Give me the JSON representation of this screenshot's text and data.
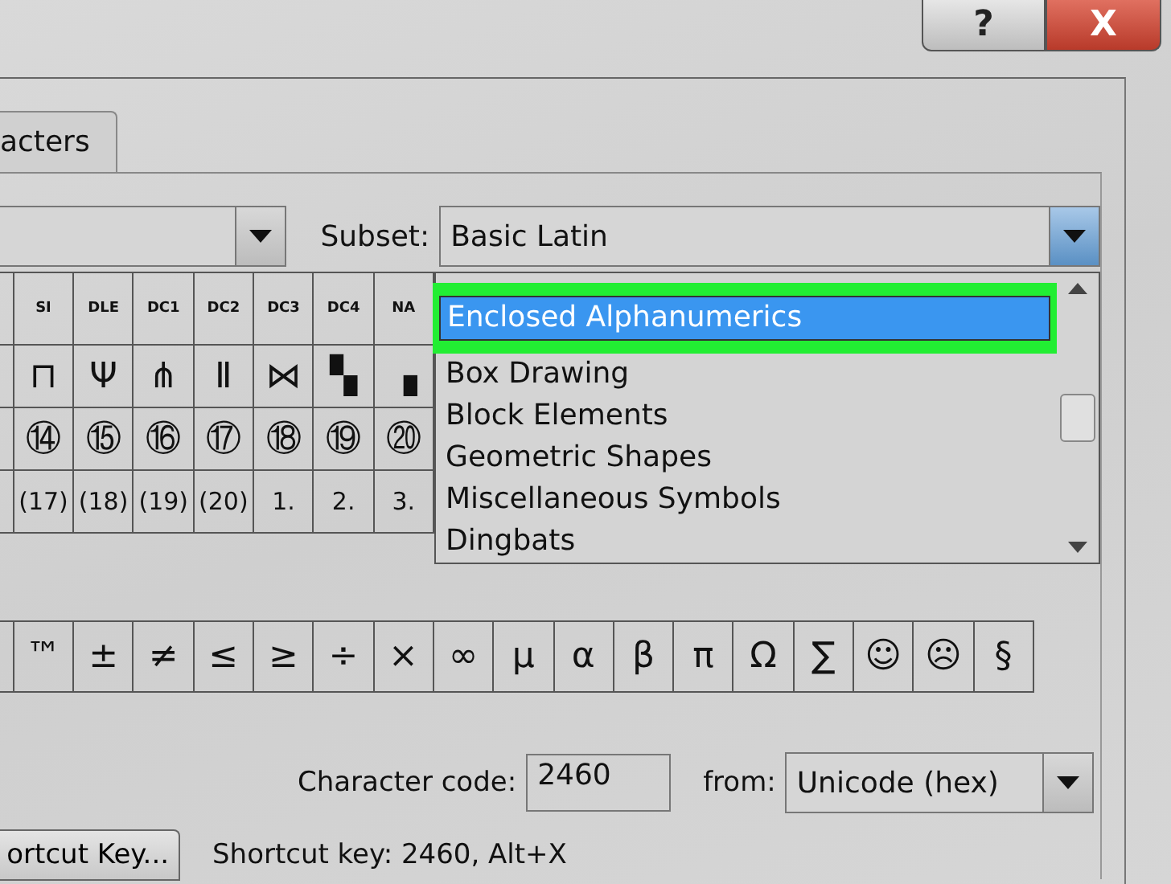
{
  "window": {
    "help_button": "?",
    "close_button": "X"
  },
  "tabs": [
    {
      "label": "acters",
      "selected": true
    }
  ],
  "subset": {
    "label": "Subset:",
    "value": "Basic Latin"
  },
  "symbol_grid": {
    "rows": [
      [
        "SI",
        "DLE",
        "DC1",
        "DC2",
        "DC3",
        "DC4",
        "NA"
      ],
      [
        "⊓",
        "Ψ",
        "⋔",
        "Ⅱ",
        "⋈",
        "▚",
        "▗"
      ],
      [
        "⑭",
        "⑮",
        "⑯",
        "⑰",
        "⑱",
        "⑲",
        "⑳"
      ],
      [
        "(17)",
        "(18)",
        "(19)",
        "(20)",
        "1.",
        "2.",
        "3."
      ]
    ]
  },
  "subset_list": [
    {
      "label": "Enclosed Alphanumerics",
      "selected": true
    },
    {
      "label": "Box Drawing",
      "selected": false
    },
    {
      "label": "Block Elements",
      "selected": false
    },
    {
      "label": "Geometric Shapes",
      "selected": false
    },
    {
      "label": "Miscellaneous Symbols",
      "selected": false
    },
    {
      "label": "Dingbats",
      "selected": false
    }
  ],
  "recently_used": [
    "™",
    "±",
    "≠",
    "≤",
    "≥",
    "÷",
    "×",
    "∞",
    "μ",
    "α",
    "β",
    "π",
    "Ω",
    "∑",
    "☺",
    "☹",
    "§"
  ],
  "character_code": {
    "label": "Character code:",
    "value": "2460"
  },
  "from": {
    "label": "from:",
    "value": "Unicode (hex)"
  },
  "shortcut_key_button": "ortcut Key...",
  "shortcut_text": "Shortcut key: 2460, Alt+X"
}
